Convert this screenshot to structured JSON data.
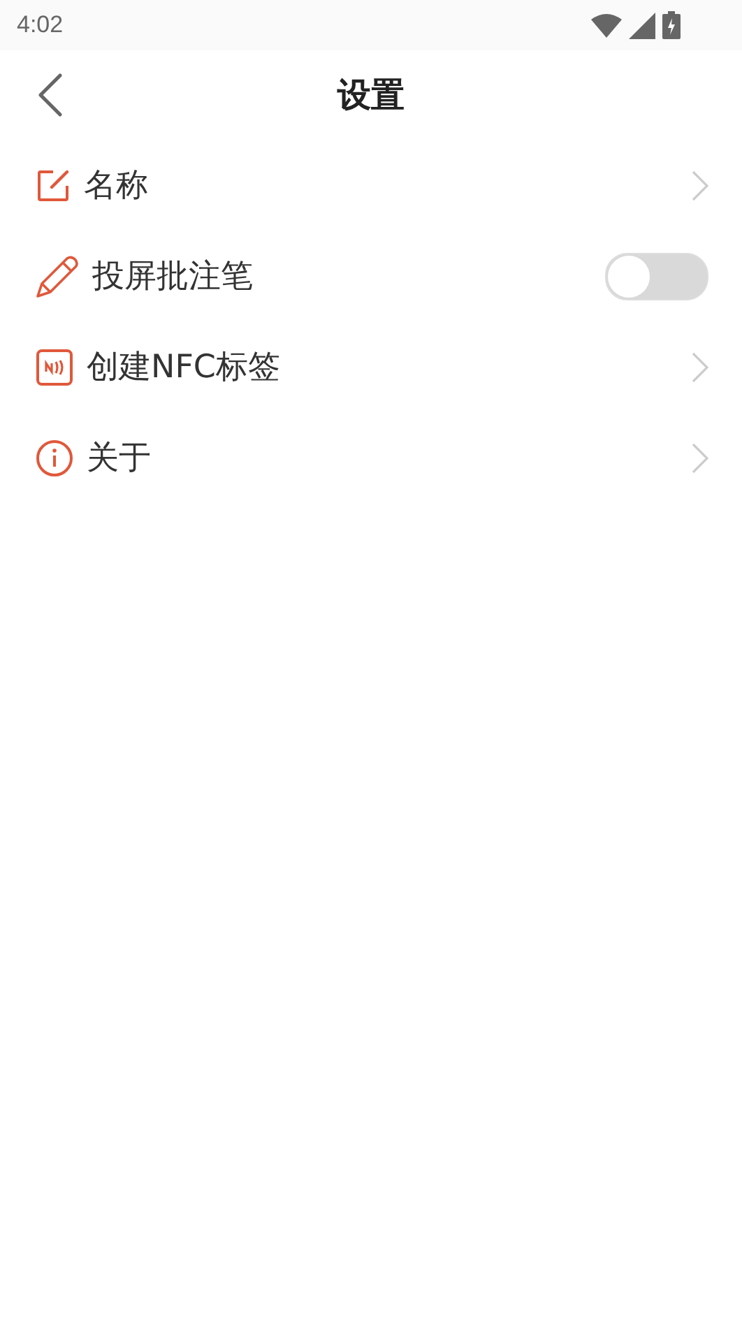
{
  "status_bar": {
    "time": "4:02"
  },
  "header": {
    "title": "设置"
  },
  "items": [
    {
      "kind": "link",
      "label": "名称"
    },
    {
      "kind": "toggle",
      "label": "投屏批注笔",
      "on": false
    },
    {
      "kind": "link",
      "label": "创建NFC标签"
    },
    {
      "kind": "link",
      "label": "关于"
    }
  ]
}
